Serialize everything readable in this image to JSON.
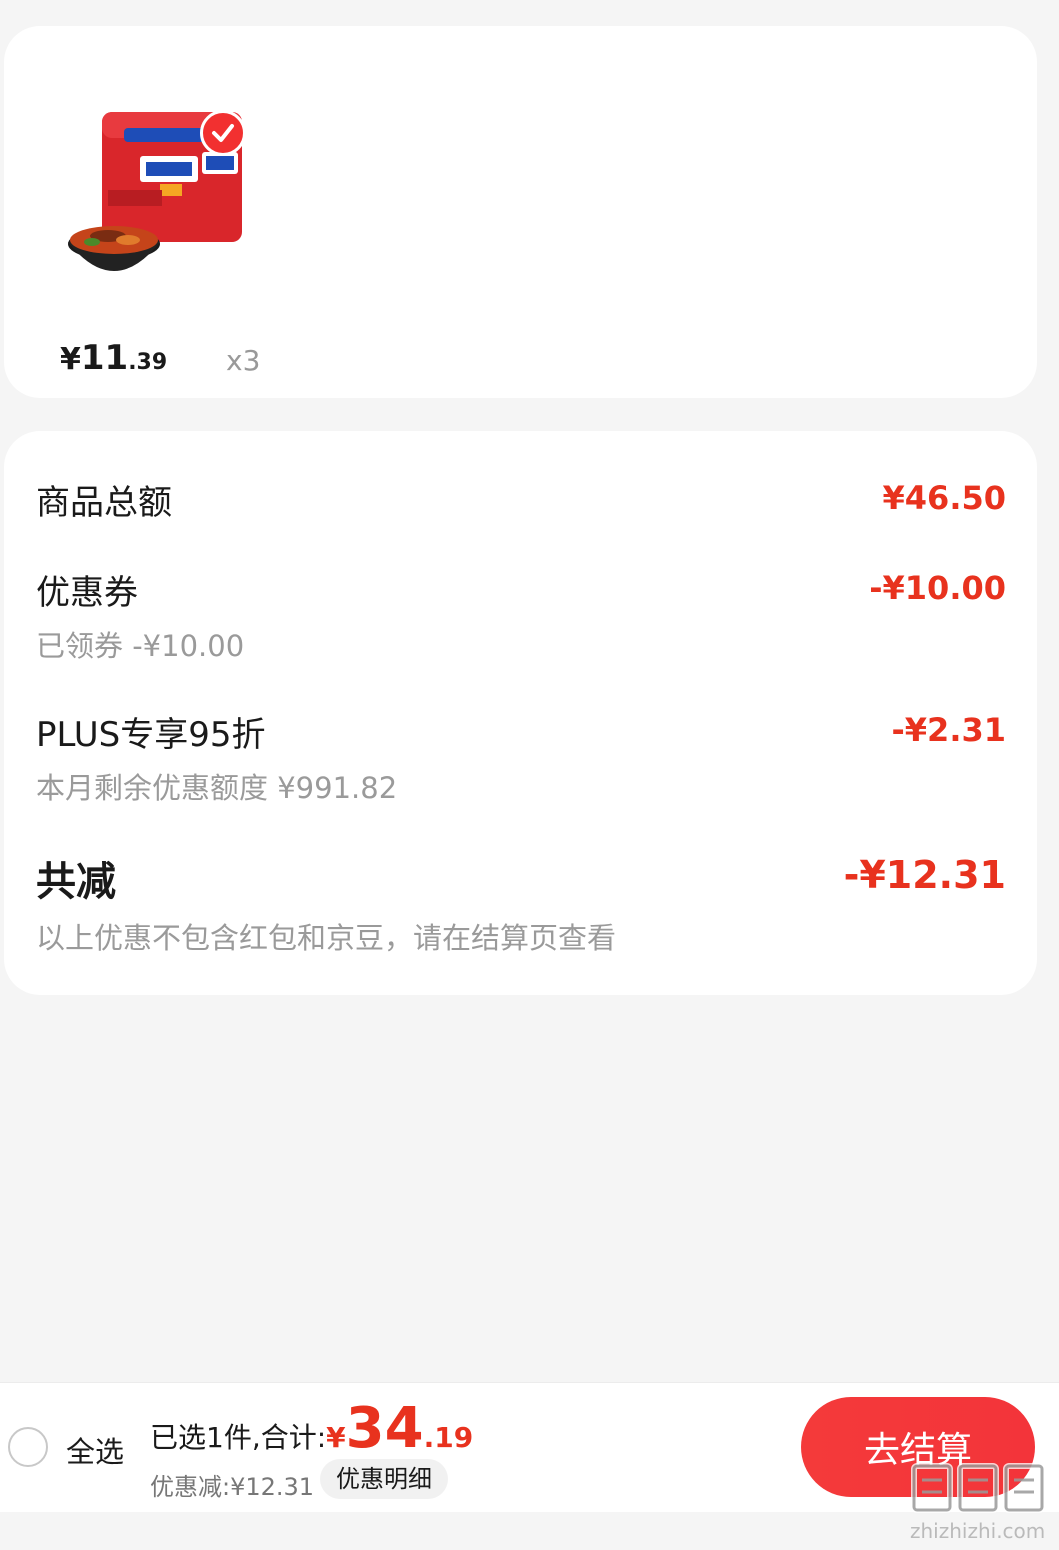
{
  "product": {
    "image_icon": "instant-noodle-pack",
    "selected": true,
    "price_yen": "¥",
    "price_int": "11",
    "price_dec": ".39",
    "quantity": "x3"
  },
  "summary": {
    "goods_total_label": "商品总额",
    "goods_total_value": "¥46.50",
    "coupon_label": "优惠券",
    "coupon_value": "-¥10.00",
    "coupon_sub": "已领券 -¥10.00",
    "plus_label": "PLUS专享95折",
    "plus_value": "-¥2.31",
    "plus_sub": "本月剩余优惠额度 ¥991.82",
    "total_off_label": "共减",
    "total_off_value": "-¥12.31",
    "note": "以上优惠不包含红包和京豆，请在结算页查看"
  },
  "bottom_bar": {
    "select_all": "全选",
    "selected_prefix": "已选1件,合计:",
    "total_yen": "¥",
    "total_int": "34",
    "total_dec": ".19",
    "discount": "优惠减:¥12.31",
    "detail_label": "优惠明细",
    "checkout_label": "去结算"
  },
  "colors": {
    "accent": "#e8321e",
    "background": "#f5f5f5"
  },
  "watermark": {
    "logo_text": "值值值",
    "site_text": "zhizhizhi.com"
  }
}
